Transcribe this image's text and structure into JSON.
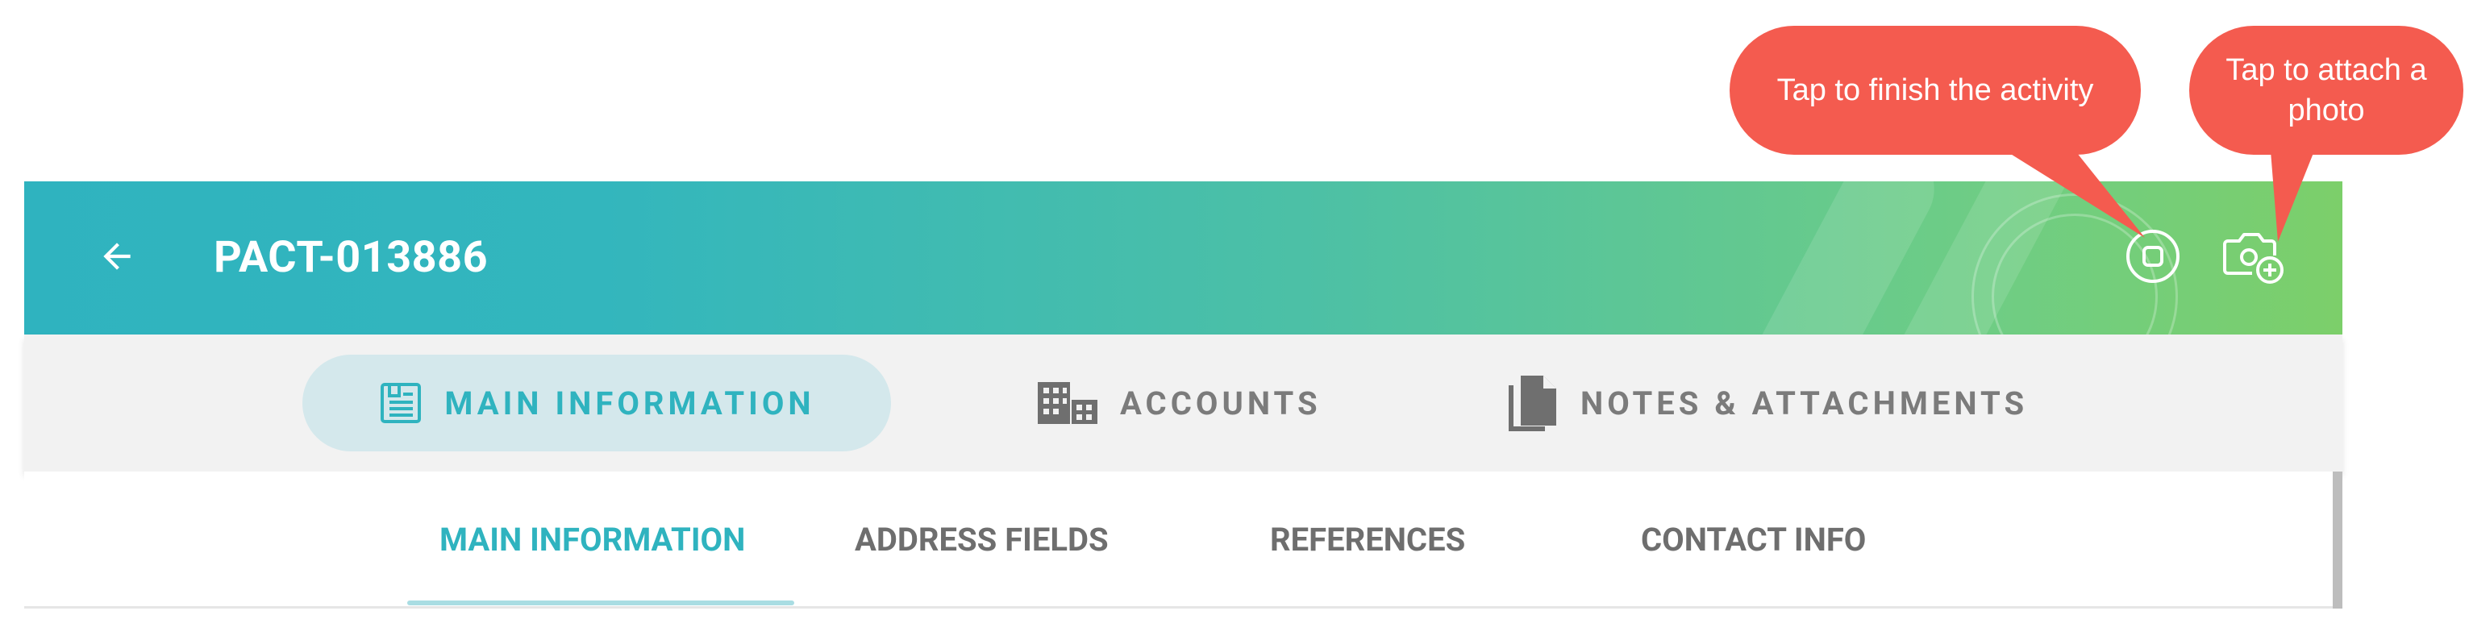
{
  "appbar": {
    "title": "PACT-013886",
    "back_icon": "arrow-left-icon",
    "finish_icon": "stop-circle-icon",
    "camera_icon": "camera-add-icon"
  },
  "main_tabs": [
    {
      "label": "MAIN INFORMATION",
      "icon": "document-list-icon",
      "active": true
    },
    {
      "label": "ACCOUNTS",
      "icon": "building-icon",
      "active": false
    },
    {
      "label": "NOTES & ATTACHMENTS",
      "icon": "files-icon",
      "active": false
    }
  ],
  "sub_tabs": [
    {
      "label": "MAIN INFORMATION",
      "active": true
    },
    {
      "label": "ADDRESS FIELDS",
      "active": false
    },
    {
      "label": "REFERENCES",
      "active": false
    },
    {
      "label": "CONTACT INFO",
      "active": false
    }
  ],
  "callouts": {
    "finish": "Tap to finish the activity",
    "photo": "Tap to attach a photo"
  },
  "colors": {
    "gradient_start": "#2fb3bf",
    "gradient_end": "#7ccf6a",
    "accent": "#2fb3bf",
    "callout": "#f45b4f",
    "active_tab_bg": "#d4e8ec"
  }
}
